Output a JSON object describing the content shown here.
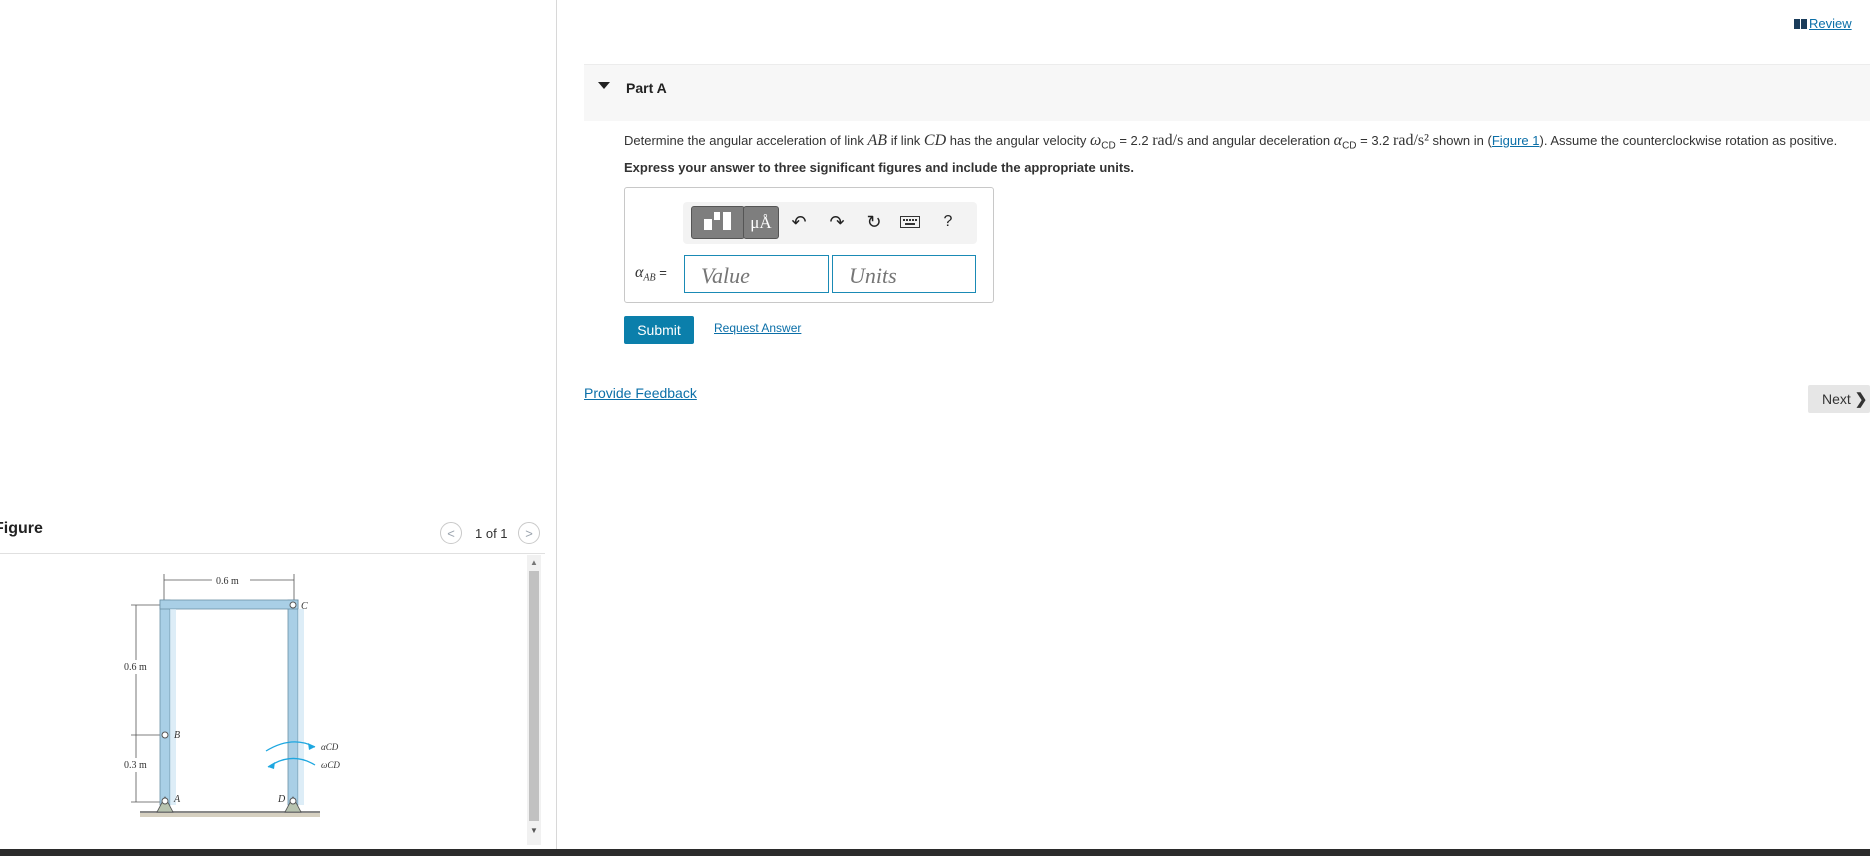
{
  "figure_panel": {
    "title": "Figure",
    "pager": "1 of 1",
    "prev_glyph": "<",
    "next_glyph": ">",
    "diagram_labels": {
      "width": "0.6 m",
      "upper_height": "0.6 m",
      "lower_height": "0.3 m",
      "point_a": "A",
      "point_b": "B",
      "point_c": "C",
      "point_d": "D",
      "alpha_cd": "αCD",
      "omega_cd": "ωCD"
    }
  },
  "header": {
    "review_label": "Review",
    "review_icon": "book-icon"
  },
  "part": {
    "title": "Part A",
    "caret_icon": "caret-down-icon",
    "question": {
      "t1": "Determine the angular acceleration of link ",
      "ab": "AB",
      "t2": " if link ",
      "cd": "CD",
      "t3": " has the angular velocity ",
      "omega": "ω",
      "omega_sub": "CD",
      "t4": " = 2.2 ",
      "unit1": "rad/s",
      "t5": " and angular deceleration ",
      "alpha": "α",
      "alpha_sub": "CD",
      "t6": " = 3.2 ",
      "unit2": "rad/s²",
      "t7": " shown in (",
      "figure_link": "Figure 1",
      "t8": "). Assume the counterclockwise rotation as positive."
    },
    "instruction": "Express your answer to three significant figures and include the appropriate units.",
    "toolbar": {
      "templates_icon": "templates-icon",
      "units_label": "μÅ",
      "undo_glyph": "↶",
      "redo_glyph": "↷",
      "reset_glyph": "↻",
      "keyboard_icon": "keyboard-icon",
      "help_label": "?"
    },
    "answer": {
      "label_symbol": "α",
      "label_sub": "AB",
      "label_eq": " =",
      "value_placeholder": "Value",
      "units_placeholder": "Units"
    },
    "submit_label": "Submit",
    "request_answer_label": "Request Answer"
  },
  "footer": {
    "feedback_label": "Provide Feedback",
    "next_label": "Next",
    "next_glyph": "❯"
  },
  "colors": {
    "accent": "#0b7fab",
    "link": "#0b6fa8",
    "diagram_link": "#a9cfe6",
    "diagram_arrow": "#1ea7e0"
  }
}
